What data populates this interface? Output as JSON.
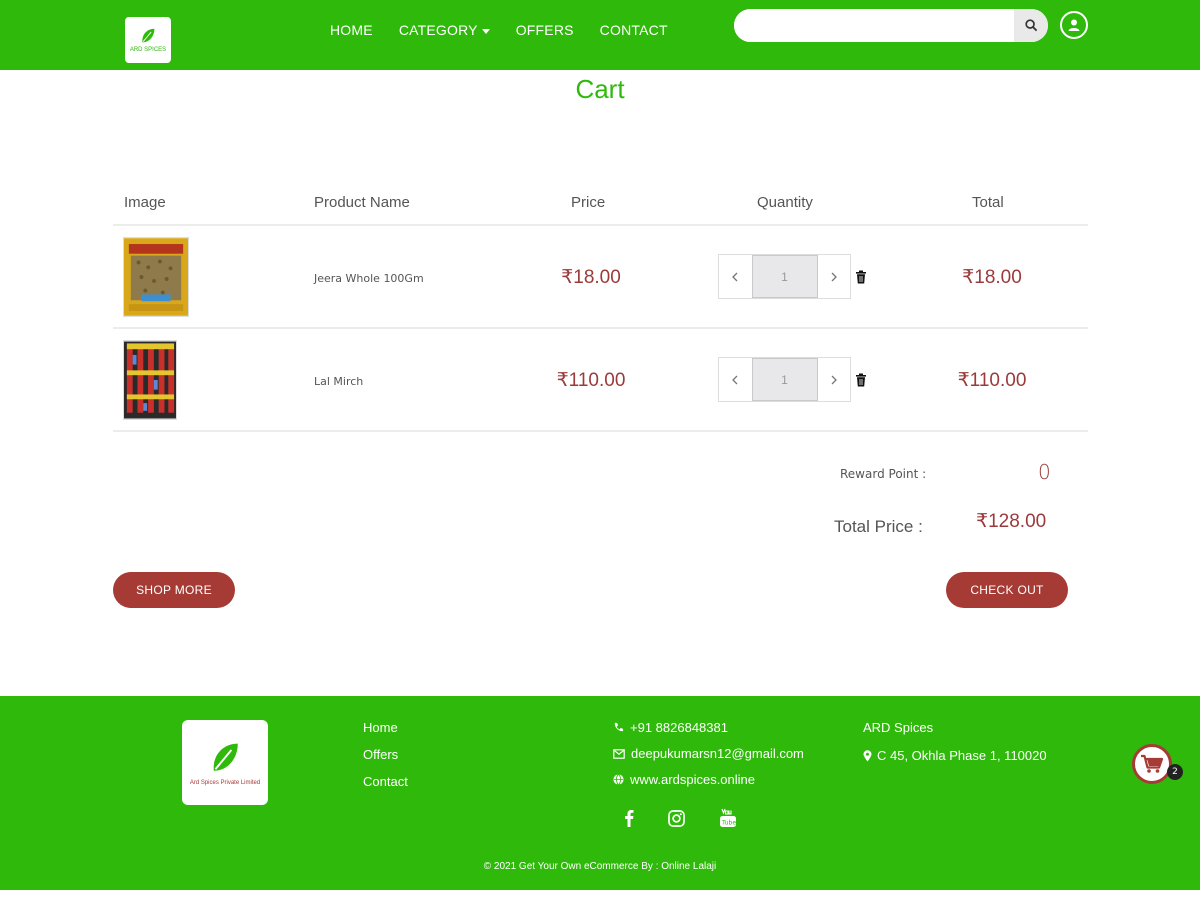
{
  "header": {
    "logo_text": "ARD SPICES",
    "nav": [
      "HOME",
      "CATEGORY",
      "OFFERS",
      "CONTACT"
    ],
    "search_placeholder": ""
  },
  "page_title": "Cart",
  "table": {
    "headers": [
      "Image",
      "Product Name",
      "Price",
      "Quantity",
      "Total"
    ],
    "rows": [
      {
        "name": "Jeera Whole 100Gm",
        "price": "₹18.00",
        "qty": "1",
        "total": "₹18.00"
      },
      {
        "name": "Lal Mirch",
        "price": "₹110.00",
        "qty": "1",
        "total": "₹110.00"
      }
    ]
  },
  "summary": {
    "reward_label": "Reward Point :",
    "reward_value": "0",
    "total_label": "Total Price :",
    "total_value": "₹128.00"
  },
  "buttons": {
    "shop_more": "SHOP MORE",
    "check_out": "CHECK OUT"
  },
  "footer": {
    "logo_text": "Ard Spices Private Limited",
    "links": [
      "Home",
      "Offers",
      "Contact"
    ],
    "phone": "+91 8826848381",
    "email": "deepukumarsn12@gmail.com",
    "website": "www.ardspices.online",
    "company": "ARD Spices",
    "address": "C 45, Okhla Phase 1, 110020",
    "copyright": "© 2021 Get Your Own eCommerce By : Online Lalaji"
  },
  "cart_count": "2",
  "colors": {
    "brand_green": "#2fba0b",
    "accent_red": "#a63b36",
    "price_color": "#9b3a3a"
  }
}
